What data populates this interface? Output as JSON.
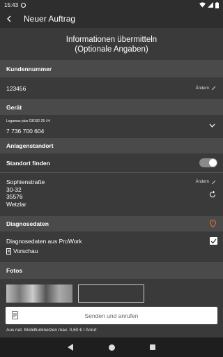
{
  "status_bar": {
    "time": "15:43"
  },
  "app_bar": {
    "title": "Neuer Auftrag"
  },
  "heading": {
    "line1": "Informationen übermitteln",
    "line2": "(Optionale Angaben)"
  },
  "customer": {
    "section": "Kundennummer",
    "value": "123456",
    "edit_label": "Ändern"
  },
  "device": {
    "section": "Gerät",
    "model": "Logamax plus GB192-25 i H",
    "number": "7 736 700 604"
  },
  "location": {
    "section": "Anlagenstandort",
    "find_label": "Standort finden",
    "toggle_on": true,
    "edit_label": "Ändern",
    "street": "Sophienstraße",
    "house": "30-32",
    "zip": "35576",
    "city": "Wetzlar"
  },
  "diagnostics": {
    "section": "Diagnosedaten",
    "item_label": "Diagnosedaten aus ProWork",
    "checked": true,
    "preview_label": "Vorschau"
  },
  "photos": {
    "section": "Fotos"
  },
  "actions": {
    "send_label": "Senden und anrufen",
    "note": "Aus nat. Mobilfunknetzen max. 0,60 € / Anruf."
  },
  "icons": [
    "back-arrow-icon",
    "pencil-icon",
    "chevron-down-icon",
    "refresh-icon",
    "location-pin-icon",
    "document-icon",
    "checkmark-icon",
    "phone-document-icon"
  ],
  "colors": {
    "bar": "#2e2e2e",
    "background": "#3a3a3a",
    "section": "#4a4a4a",
    "pin_accent": "#e07a3a"
  }
}
